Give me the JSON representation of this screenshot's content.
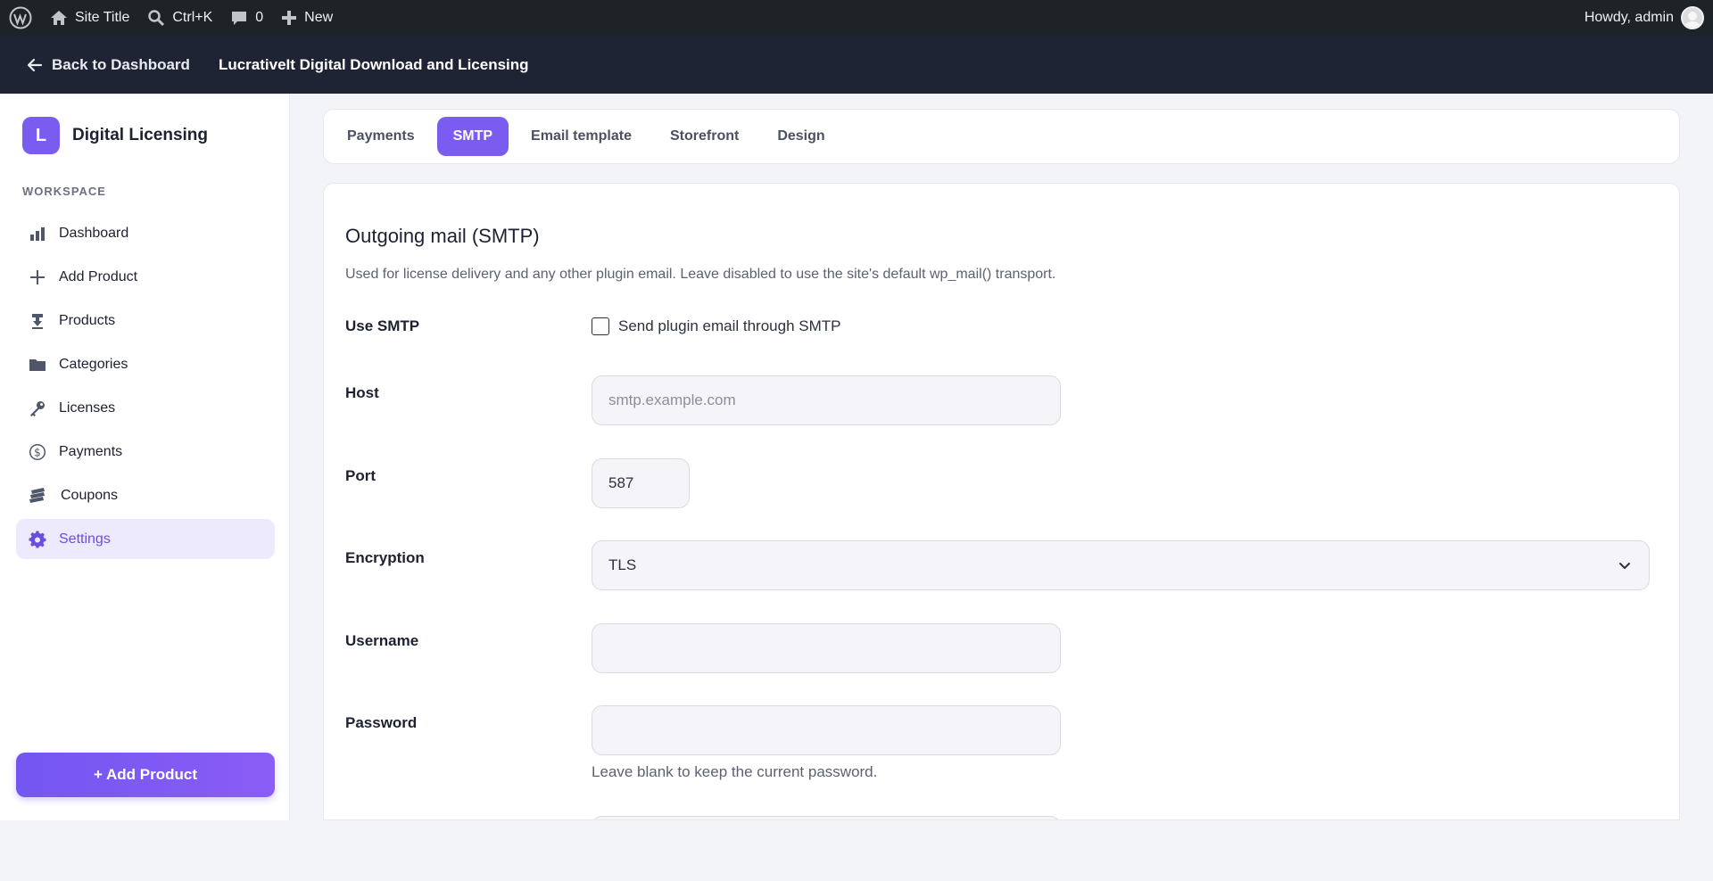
{
  "admin_bar": {
    "site_title": "Site Title",
    "search_shortcut": "Ctrl+K",
    "comments_count": "0",
    "new_label": "New",
    "howdy": "Howdy, admin"
  },
  "plugin_header": {
    "back_label": "Back to Dashboard",
    "title": "LucrativeIt Digital Download and Licensing"
  },
  "sidebar": {
    "brand_initial": "L",
    "brand_name": "Digital Licensing",
    "section_label": "WORKSPACE",
    "items": [
      {
        "label": "Dashboard",
        "icon": "bar-chart-icon"
      },
      {
        "label": "Add Product",
        "icon": "plus-icon"
      },
      {
        "label": "Products",
        "icon": "download-icon"
      },
      {
        "label": "Categories",
        "icon": "folder-icon"
      },
      {
        "label": "Licenses",
        "icon": "key-icon"
      },
      {
        "label": "Payments",
        "icon": "dollar-icon"
      },
      {
        "label": "Coupons",
        "icon": "tickets-icon"
      },
      {
        "label": "Settings",
        "icon": "gear-icon"
      }
    ],
    "active_item": "Settings",
    "add_button": "+ Add Product"
  },
  "tabs": {
    "items": [
      "Payments",
      "SMTP",
      "Email template",
      "Storefront",
      "Design"
    ],
    "active": "SMTP"
  },
  "smtp": {
    "title": "Outgoing mail (SMTP)",
    "description": "Used for license delivery and any other plugin email. Leave disabled to use the site's default wp_mail() transport.",
    "use_smtp_label": "Use SMTP",
    "use_smtp_checkbox_label": "Send plugin email through SMTP",
    "use_smtp_checked": false,
    "host_label": "Host",
    "host_placeholder": "smtp.example.com",
    "host_value": "",
    "port_label": "Port",
    "port_value": "587",
    "encryption_label": "Encryption",
    "encryption_value": "TLS",
    "username_label": "Username",
    "username_value": "",
    "password_label": "Password",
    "password_value": "",
    "password_help": "Leave blank to keep the current password."
  },
  "colors": {
    "accent": "#7b5cf0",
    "admin_bar": "#1d2327",
    "plugin_header": "#1e2433",
    "active_nav_bg": "#eeeafd"
  }
}
